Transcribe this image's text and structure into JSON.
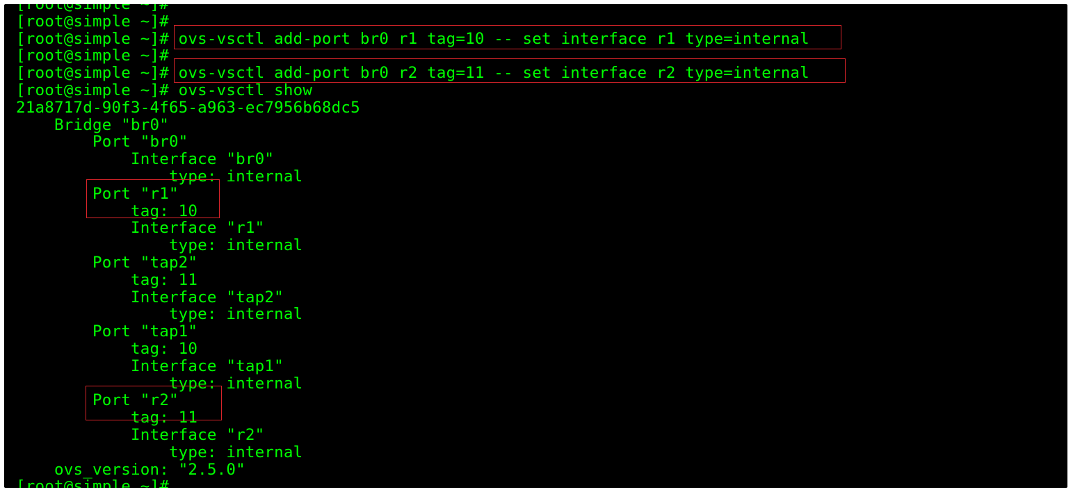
{
  "terminal": {
    "colors": {
      "background": "#000000",
      "text": "#00ff00",
      "highlight": "#d9242a"
    },
    "lines": [
      "[root@simple ~]#",
      "[root@simple ~]#",
      "[root@simple ~]# ovs-vsctl add-port br0 r1 tag=10 -- set interface r1 type=internal",
      "[root@simple ~]#",
      "[root@simple ~]# ovs-vsctl add-port br0 r2 tag=11 -- set interface r2 type=internal",
      "[root@simple ~]# ovs-vsctl show",
      "21a8717d-90f3-4f65-a963-ec7956b68dc5",
      "    Bridge \"br0\"",
      "        Port \"br0\"",
      "            Interface \"br0\"",
      "                type: internal",
      "        Port \"r1\"",
      "            tag: 10",
      "            Interface \"r1\"",
      "                type: internal",
      "        Port \"tap2\"",
      "            tag: 11",
      "            Interface \"tap2\"",
      "                type: internal",
      "        Port \"tap1\"",
      "            tag: 10",
      "            Interface \"tap1\"",
      "                type: internal",
      "        Port \"r2\"",
      "            tag: 11",
      "            Interface \"r2\"",
      "                type: internal",
      "    ovs_version: \"2.5.0\"",
      "[root@simple ~]#"
    ]
  }
}
